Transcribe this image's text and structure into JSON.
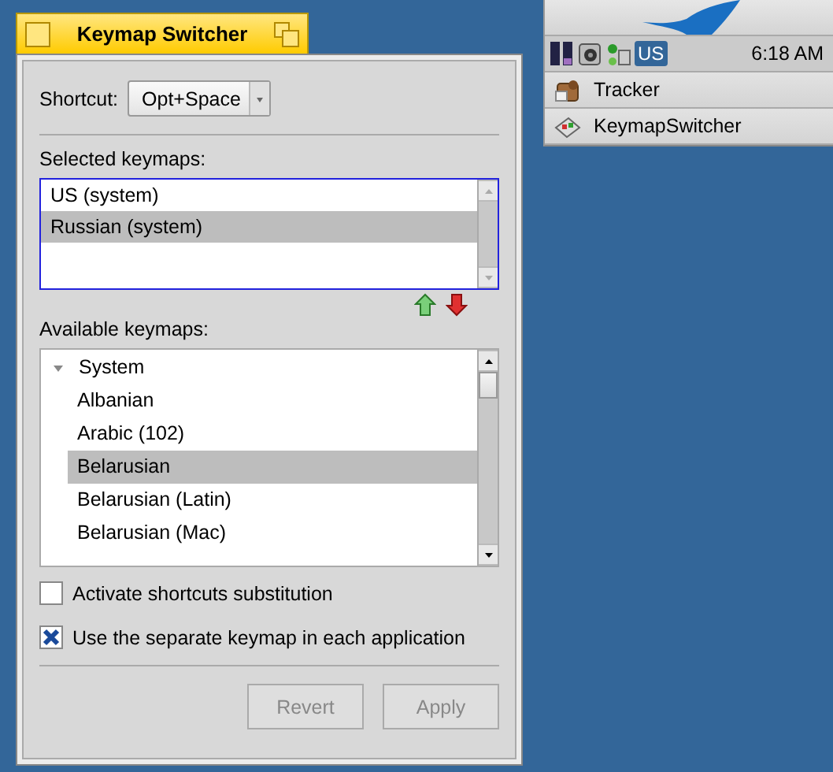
{
  "window": {
    "title": "Keymap Switcher",
    "active": true
  },
  "shortcut": {
    "label": "Shortcut:",
    "value": "Opt+Space"
  },
  "selected_keymaps": {
    "label": "Selected keymaps:",
    "focused": true,
    "items": [
      {
        "label": "US (system)",
        "selected": false
      },
      {
        "label": "Russian (system)",
        "selected": true
      }
    ]
  },
  "available_keymaps": {
    "label": "Available keymaps:",
    "tree": [
      {
        "label": "System",
        "expanded": true,
        "selected": false,
        "children": [
          {
            "label": "Albanian",
            "selected": false
          },
          {
            "label": "Arabic (102)",
            "selected": false
          },
          {
            "label": "Belarusian",
            "selected": true
          },
          {
            "label": "Belarusian (Latin)",
            "selected": false
          },
          {
            "label": "Belarusian (Mac)",
            "selected": false
          }
        ]
      }
    ]
  },
  "options": [
    {
      "label": "Activate shortcuts substitution",
      "checked": false
    },
    {
      "label": "Use the separate keymap in each application",
      "checked": true
    }
  ],
  "buttons": [
    {
      "label": "Revert",
      "disabled": true
    },
    {
      "label": "Apply",
      "disabled": true
    }
  ],
  "deskbar": {
    "keymap_badge": "US",
    "clock": "6:18 AM",
    "apps": [
      {
        "label": "Tracker",
        "kind": "tracker"
      },
      {
        "label": "KeymapSwitcher",
        "kind": "keymap"
      }
    ]
  }
}
